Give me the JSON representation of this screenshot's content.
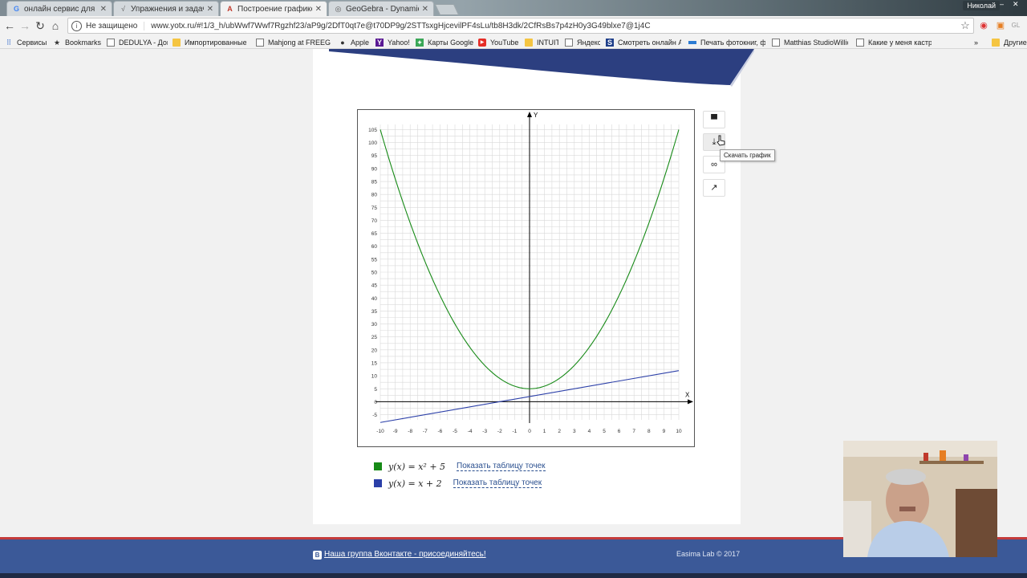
{
  "browser": {
    "tabs": [
      {
        "label": "онлайн сервис для изу",
        "favicon": "G",
        "active": false
      },
      {
        "label": "Упражнения и задачи",
        "favicon": "√",
        "active": false
      },
      {
        "label": "Построение графиков",
        "favicon": "A",
        "active": true
      },
      {
        "label": "GeoGebra - Dynamic M",
        "favicon": "◎",
        "active": false
      }
    ],
    "profile_name": "Николай",
    "security_label": "Не защищено",
    "url": "www.yotx.ru/#!1/3_h/ubWwf7Wwf7Rgzhf23/aP9g/2DfT0qt7e@t70DP9g/2STTsxgHjcevilPF4sLu/tb8H3dk/2CfRsBs7p4zH0y3G49blxe7@1j4C",
    "bookmarks": [
      {
        "label": "Сервисы",
        "icon": "apps-grid-icon"
      },
      {
        "label": "Bookmarks",
        "icon": "star-icon"
      },
      {
        "label": "DEDULYA - Дом",
        "icon": "page-icon"
      },
      {
        "label": "Импортированные",
        "icon": "folder-icon"
      },
      {
        "label": "Mahjong at FREEGAM",
        "icon": "page-icon"
      },
      {
        "label": "Apple",
        "icon": "apple-icon"
      },
      {
        "label": "Yahoo!",
        "icon": "yahoo-icon"
      },
      {
        "label": "Карты Google",
        "icon": "maps-icon"
      },
      {
        "label": "YouTube",
        "icon": "youtube-icon"
      },
      {
        "label": "INTUIT",
        "icon": "folder-icon"
      },
      {
        "label": "Яндекс",
        "icon": "page-icon"
      },
      {
        "label": "Смотреть онлайн А",
        "icon": "s-icon"
      },
      {
        "label": "Печать фотокниг, ф",
        "icon": "photobook-icon"
      },
      {
        "label": "Matthias StudioWillic",
        "icon": "page-icon"
      },
      {
        "label": "Какие у меня кастр",
        "icon": "page-icon"
      }
    ],
    "bookmarks_overflow": "»",
    "other_bookmarks": "Другие"
  },
  "page": {
    "side_buttons": [
      {
        "name": "print-button",
        "icon": "printer-icon"
      },
      {
        "name": "download-graph-button",
        "icon": "download-icon"
      },
      {
        "name": "link-button",
        "icon": "link-icon"
      },
      {
        "name": "share-button",
        "icon": "share-icon"
      }
    ],
    "tooltip": "Скачать график",
    "legend": [
      {
        "formula_text": "y(x) = x² + 5",
        "color": "#178a17",
        "link": "Показать таблицу точек"
      },
      {
        "formula_text": "y(x) = x + 2",
        "color": "#2b3fa8",
        "link": "Показать таблицу точек"
      }
    ],
    "footer": {
      "vk_link": "Наша группа Вконтакте - присоединяйтесь!",
      "vk_icon_letter": "В",
      "copyright": "Easima Lab © 2017"
    }
  },
  "chart_data": {
    "type": "line",
    "xlabel": "X",
    "ylabel": "Y",
    "xlim": [
      -10,
      10
    ],
    "ylim": [
      -7,
      107
    ],
    "x_ticks": [
      -10,
      -9,
      -8,
      -7,
      -6,
      -5,
      -4,
      -3,
      -2,
      -1,
      0,
      1,
      2,
      3,
      4,
      5,
      6,
      7,
      8,
      9,
      10
    ],
    "y_ticks": [
      -5,
      0,
      5,
      10,
      15,
      20,
      25,
      30,
      35,
      40,
      45,
      50,
      55,
      60,
      65,
      70,
      75,
      80,
      85,
      90,
      95,
      100,
      105
    ],
    "grid": true,
    "series": [
      {
        "name": "y(x) = x² + 5",
        "color": "#178a17",
        "x": [
          -10,
          -9,
          -8,
          -7,
          -6,
          -5,
          -4,
          -3,
          -2,
          -1,
          0,
          1,
          2,
          3,
          4,
          5,
          6,
          7,
          8,
          9,
          10
        ],
        "y": [
          105,
          86,
          69,
          54,
          41,
          30,
          21,
          14,
          9,
          6,
          5,
          6,
          9,
          14,
          21,
          30,
          41,
          54,
          69,
          86,
          105
        ]
      },
      {
        "name": "y(x) = x + 2",
        "color": "#2b3fa8",
        "x": [
          -10,
          10
        ],
        "y": [
          -8,
          12
        ]
      }
    ]
  }
}
